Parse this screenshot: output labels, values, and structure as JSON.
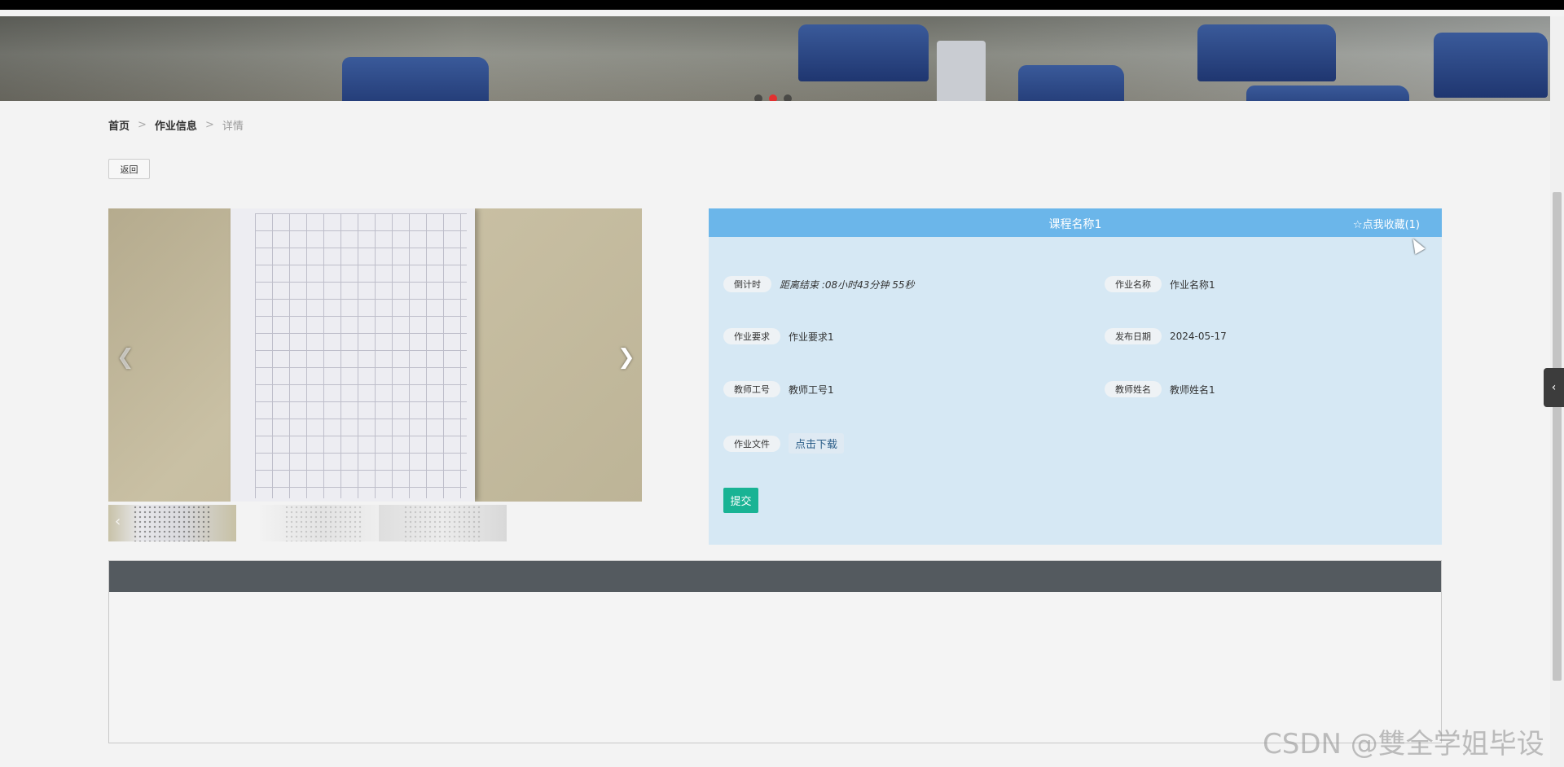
{
  "banner": {
    "slides": 3,
    "active_slide": 2
  },
  "breadcrumb": {
    "home": "首页",
    "section": "作业信息",
    "current": "详情",
    "separator": ">"
  },
  "back_button": "返回",
  "gallery": {
    "prev_icon": "chevron-left-icon",
    "next_icon": "chevron-right-icon",
    "thumbnail_count": 3
  },
  "detail": {
    "title": "课程名称1",
    "favorite": "☆点我收藏(1)",
    "fields": {
      "countdown_label": "倒计时",
      "countdown_value": "距离结束 :08小时43分钟 55秒",
      "homework_name_label": "作业名称",
      "homework_name_value": "作业名称1",
      "requirement_label": "作业要求",
      "requirement_value": "作业要求1",
      "publish_date_label": "发布日期",
      "publish_date_value": "2024-05-17",
      "teacher_id_label": "教师工号",
      "teacher_id_value": "教师工号1",
      "teacher_name_label": "教师姓名",
      "teacher_name_value": "教师姓名1",
      "file_label": "作业文件",
      "file_link": "点击下载"
    },
    "submit": "提交"
  },
  "watermark": "CSDN @雙全学姐毕设",
  "colors": {
    "header": "#6bb6ea",
    "panel": "#d6e8f4",
    "submit": "#19b394",
    "dark_bar": "#545a5f",
    "active_dot": "#e23030"
  }
}
